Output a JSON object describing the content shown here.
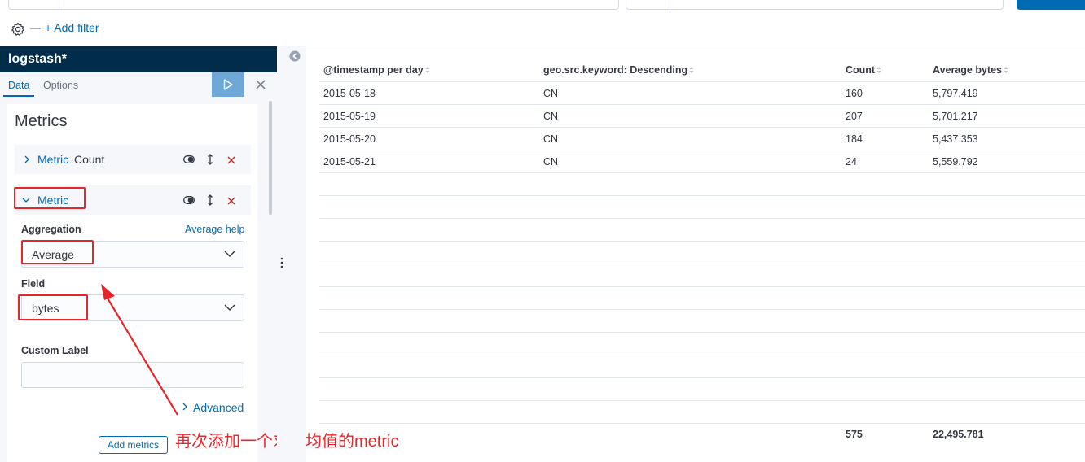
{
  "query_bar": {
    "add_filter_label": "+ Add filter"
  },
  "sidebar": {
    "title": "logstash*",
    "tabs": [
      {
        "label": "Data",
        "active": true
      },
      {
        "label": "Options",
        "active": false
      }
    ],
    "section_title": "Metrics",
    "metric_count": {
      "prefix": "Metric",
      "name": "Count"
    },
    "metric_new": {
      "label": "Metric",
      "aggregation_label": "Aggregation",
      "aggregation_help": "Average help",
      "aggregation_value": "Average",
      "field_label": "Field",
      "field_value": "bytes",
      "custom_label_label": "Custom Label",
      "custom_label_value": "",
      "advanced_label": "Advanced"
    },
    "add_metrics_label": "Add metrics",
    "annotation_text": "再次添加一个求平均值的metric"
  },
  "table": {
    "columns": [
      "@timestamp per day",
      "geo.src.keyword: Descending",
      "Count",
      "Average bytes"
    ],
    "rows": [
      [
        "2015-05-18",
        "CN",
        "160",
        "5,797.419"
      ],
      [
        "2015-05-19",
        "CN",
        "207",
        "5,701.217"
      ],
      [
        "2015-05-20",
        "CN",
        "184",
        "5,437.353"
      ],
      [
        "2015-05-21",
        "CN",
        "24",
        "5,559.792"
      ]
    ],
    "footer": {
      "count_total": "575",
      "avg_total": "22,495.781"
    }
  },
  "colors": {
    "accent": "#006bb4",
    "sidebar_header": "#012c4a",
    "annotation_red": "#e7262b",
    "delete_red": "#bd271e"
  }
}
